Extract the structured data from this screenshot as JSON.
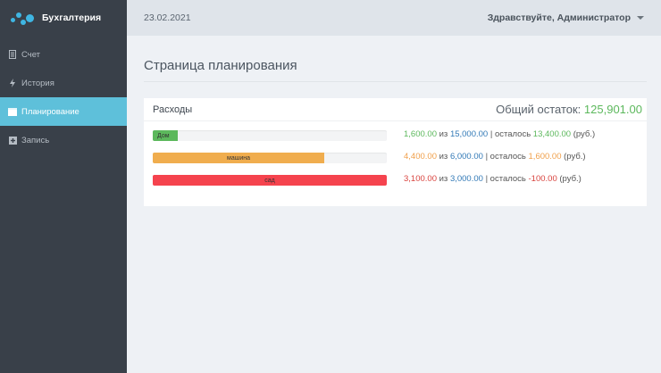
{
  "app": {
    "name": "Бухгалтерия",
    "brand_color": "#3fb6e3",
    "logo_icon": "dots-logo-icon"
  },
  "sidebar": {
    "items": [
      {
        "label": "Счет",
        "icon": "file-icon",
        "active": false
      },
      {
        "label": "История",
        "icon": "bolt-icon",
        "active": false
      },
      {
        "label": "Планирование",
        "icon": "calendar-icon",
        "active": true
      },
      {
        "label": "Запись",
        "icon": "plus-square-icon",
        "active": false
      }
    ]
  },
  "header": {
    "date": "23.02.2021",
    "user_greeting": "Здравствуйте, Администратор"
  },
  "page": {
    "title": "Страница планирования"
  },
  "panel": {
    "title": "Расходы",
    "total_label": "Общий остаток:",
    "total_value": "125,901.00",
    "rows": [
      {
        "category": "Дом",
        "spent": "1,600.00",
        "of_word": "из",
        "limit": "15,000.00",
        "sep": "|",
        "left_word": "осталось",
        "remaining": "13,400.00",
        "currency": "(руб.)",
        "fill_fraction": 0.107,
        "color": "#5cb85c"
      },
      {
        "category": "машина",
        "spent": "4,400.00",
        "of_word": "из",
        "limit": "6,000.00",
        "sep": "|",
        "left_word": "осталось",
        "remaining": "1,600.00",
        "currency": "(руб.)",
        "fill_fraction": 0.733,
        "color": "#f0ad4e"
      },
      {
        "category": "сад",
        "spent": "3,100.00",
        "of_word": "из",
        "limit": "3,000.00",
        "sep": "|",
        "left_word": "осталось",
        "remaining": "-100.00",
        "currency": "(руб.)",
        "fill_fraction": 1.0,
        "color": "#f5434e"
      }
    ]
  }
}
